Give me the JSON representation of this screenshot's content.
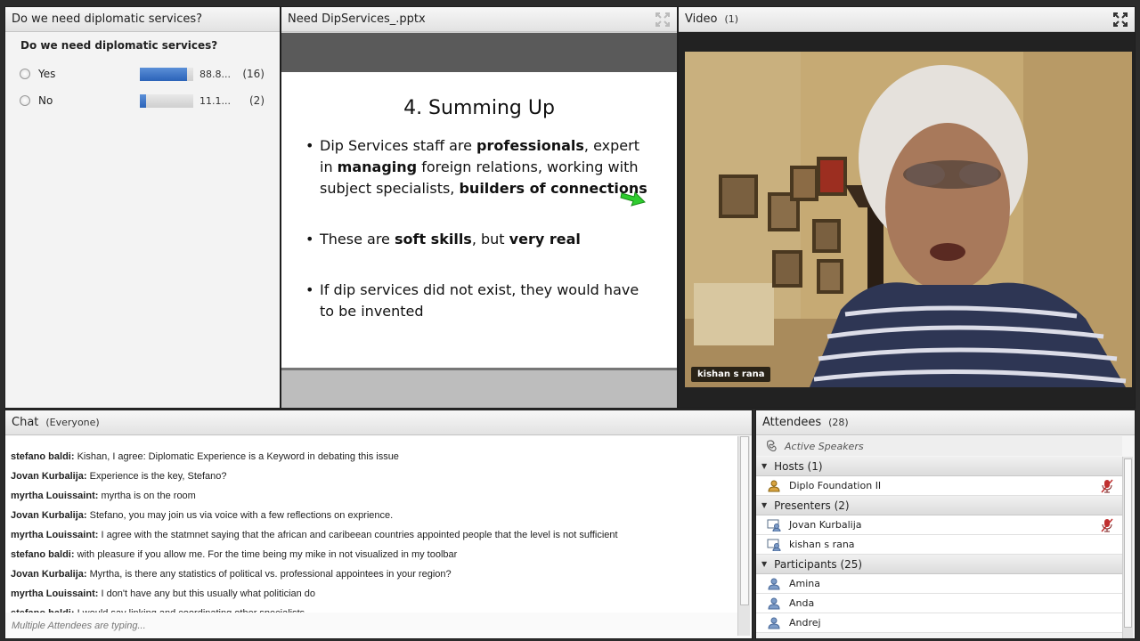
{
  "poll": {
    "title": "Do we need diplomatic services?",
    "question": "Do we need diplomatic services?",
    "options": [
      {
        "label": "Yes",
        "percent_text": "88.8...",
        "count_text": "(16)",
        "fraction": 0.888
      },
      {
        "label": "No",
        "percent_text": "11.1...",
        "count_text": "(2)",
        "fraction": 0.111
      }
    ]
  },
  "share": {
    "title": "Need DipServices_.pptx",
    "slide": {
      "title": "4. Summing Up",
      "bullets": [
        [
          {
            "t": "Dip Services staff are "
          },
          {
            "t": "professionals",
            "b": true
          },
          {
            "t": ", expert in "
          },
          {
            "t": "managing",
            "b": true
          },
          {
            "t": " foreign relations, working with subject specialists, "
          },
          {
            "t": "builders of connections",
            "b": true
          }
        ],
        [
          {
            "t": "These are "
          },
          {
            "t": "soft skills",
            "b": true
          },
          {
            "t": ", but "
          },
          {
            "t": "very real",
            "b": true
          }
        ],
        [
          {
            "t": "If dip services did not exist, they would have to be invented"
          }
        ]
      ]
    }
  },
  "video": {
    "title": "Video",
    "count": "(1)",
    "speaker_name": "kishan s rana"
  },
  "chat": {
    "title": "Chat",
    "scope": "(Everyone)",
    "messages": [
      {
        "who": "stefano baldi:",
        "text": " Kishan, I agree: Diplomatic Experience is a Keyword in debating this issue"
      },
      {
        "who": "Jovan Kurbalija:",
        "text": " Experience is the key, Stefano?"
      },
      {
        "who": "myrtha Louissaint:",
        "text": " myrtha is on the room"
      },
      {
        "who": "Jovan Kurbalija:",
        "text": " Stefano, you may join us via voice with a few reflections on exprience."
      },
      {
        "who": "myrtha Louissaint:",
        "text": " I agree with the statmnet saying that the african and caribeean countries appointed people that the level is not sufficient"
      },
      {
        "who": "stefano baldi:",
        "text": " with pleasure if you allow me. For the time being my mike in not visualized in my toolbar"
      },
      {
        "who": "Jovan Kurbalija:",
        "text": " Myrtha, is there any statistics of political vs. professional appointees in your region?"
      },
      {
        "who": "myrtha Louissaint:",
        "text": " I don't have any but this usually what politician do"
      },
      {
        "who": "stefano baldi:",
        "text": " I would say linking and coordinating other specialists"
      }
    ],
    "typing": "Multiple Attendees are typing..."
  },
  "attendees": {
    "title": "Attendees",
    "count": "(28)",
    "active_speakers": "Active Speakers",
    "hosts_label": "Hosts (1)",
    "hosts": [
      {
        "name": "Diplo Foundation II",
        "mic": true
      }
    ],
    "presenters_label": "Presenters (2)",
    "presenters": [
      {
        "name": "Jovan Kurbalija",
        "mic": true
      },
      {
        "name": "kishan s rana",
        "mic": false
      }
    ],
    "participants_label": "Participants (25)",
    "participants": [
      {
        "name": "Amina"
      },
      {
        "name": "Anda"
      },
      {
        "name": "Andrej"
      }
    ]
  }
}
